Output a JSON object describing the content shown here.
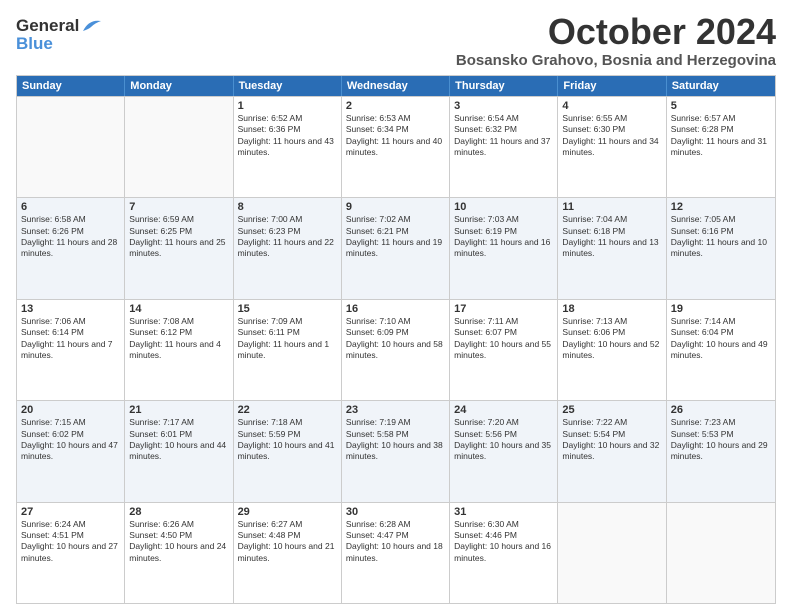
{
  "logo": {
    "general": "General",
    "blue": "Blue"
  },
  "title": "October 2024",
  "location": "Bosansko Grahovo, Bosnia and Herzegovina",
  "days_of_week": [
    "Sunday",
    "Monday",
    "Tuesday",
    "Wednesday",
    "Thursday",
    "Friday",
    "Saturday"
  ],
  "weeks": [
    [
      {
        "day": "",
        "sunrise": "",
        "sunset": "",
        "daylight": ""
      },
      {
        "day": "",
        "sunrise": "",
        "sunset": "",
        "daylight": ""
      },
      {
        "day": "1",
        "sunrise": "Sunrise: 6:52 AM",
        "sunset": "Sunset: 6:36 PM",
        "daylight": "Daylight: 11 hours and 43 minutes."
      },
      {
        "day": "2",
        "sunrise": "Sunrise: 6:53 AM",
        "sunset": "Sunset: 6:34 PM",
        "daylight": "Daylight: 11 hours and 40 minutes."
      },
      {
        "day": "3",
        "sunrise": "Sunrise: 6:54 AM",
        "sunset": "Sunset: 6:32 PM",
        "daylight": "Daylight: 11 hours and 37 minutes."
      },
      {
        "day": "4",
        "sunrise": "Sunrise: 6:55 AM",
        "sunset": "Sunset: 6:30 PM",
        "daylight": "Daylight: 11 hours and 34 minutes."
      },
      {
        "day": "5",
        "sunrise": "Sunrise: 6:57 AM",
        "sunset": "Sunset: 6:28 PM",
        "daylight": "Daylight: 11 hours and 31 minutes."
      }
    ],
    [
      {
        "day": "6",
        "sunrise": "Sunrise: 6:58 AM",
        "sunset": "Sunset: 6:26 PM",
        "daylight": "Daylight: 11 hours and 28 minutes."
      },
      {
        "day": "7",
        "sunrise": "Sunrise: 6:59 AM",
        "sunset": "Sunset: 6:25 PM",
        "daylight": "Daylight: 11 hours and 25 minutes."
      },
      {
        "day": "8",
        "sunrise": "Sunrise: 7:00 AM",
        "sunset": "Sunset: 6:23 PM",
        "daylight": "Daylight: 11 hours and 22 minutes."
      },
      {
        "day": "9",
        "sunrise": "Sunrise: 7:02 AM",
        "sunset": "Sunset: 6:21 PM",
        "daylight": "Daylight: 11 hours and 19 minutes."
      },
      {
        "day": "10",
        "sunrise": "Sunrise: 7:03 AM",
        "sunset": "Sunset: 6:19 PM",
        "daylight": "Daylight: 11 hours and 16 minutes."
      },
      {
        "day": "11",
        "sunrise": "Sunrise: 7:04 AM",
        "sunset": "Sunset: 6:18 PM",
        "daylight": "Daylight: 11 hours and 13 minutes."
      },
      {
        "day": "12",
        "sunrise": "Sunrise: 7:05 AM",
        "sunset": "Sunset: 6:16 PM",
        "daylight": "Daylight: 11 hours and 10 minutes."
      }
    ],
    [
      {
        "day": "13",
        "sunrise": "Sunrise: 7:06 AM",
        "sunset": "Sunset: 6:14 PM",
        "daylight": "Daylight: 11 hours and 7 minutes."
      },
      {
        "day": "14",
        "sunrise": "Sunrise: 7:08 AM",
        "sunset": "Sunset: 6:12 PM",
        "daylight": "Daylight: 11 hours and 4 minutes."
      },
      {
        "day": "15",
        "sunrise": "Sunrise: 7:09 AM",
        "sunset": "Sunset: 6:11 PM",
        "daylight": "Daylight: 11 hours and 1 minute."
      },
      {
        "day": "16",
        "sunrise": "Sunrise: 7:10 AM",
        "sunset": "Sunset: 6:09 PM",
        "daylight": "Daylight: 10 hours and 58 minutes."
      },
      {
        "day": "17",
        "sunrise": "Sunrise: 7:11 AM",
        "sunset": "Sunset: 6:07 PM",
        "daylight": "Daylight: 10 hours and 55 minutes."
      },
      {
        "day": "18",
        "sunrise": "Sunrise: 7:13 AM",
        "sunset": "Sunset: 6:06 PM",
        "daylight": "Daylight: 10 hours and 52 minutes."
      },
      {
        "day": "19",
        "sunrise": "Sunrise: 7:14 AM",
        "sunset": "Sunset: 6:04 PM",
        "daylight": "Daylight: 10 hours and 49 minutes."
      }
    ],
    [
      {
        "day": "20",
        "sunrise": "Sunrise: 7:15 AM",
        "sunset": "Sunset: 6:02 PM",
        "daylight": "Daylight: 10 hours and 47 minutes."
      },
      {
        "day": "21",
        "sunrise": "Sunrise: 7:17 AM",
        "sunset": "Sunset: 6:01 PM",
        "daylight": "Daylight: 10 hours and 44 minutes."
      },
      {
        "day": "22",
        "sunrise": "Sunrise: 7:18 AM",
        "sunset": "Sunset: 5:59 PM",
        "daylight": "Daylight: 10 hours and 41 minutes."
      },
      {
        "day": "23",
        "sunrise": "Sunrise: 7:19 AM",
        "sunset": "Sunset: 5:58 PM",
        "daylight": "Daylight: 10 hours and 38 minutes."
      },
      {
        "day": "24",
        "sunrise": "Sunrise: 7:20 AM",
        "sunset": "Sunset: 5:56 PM",
        "daylight": "Daylight: 10 hours and 35 minutes."
      },
      {
        "day": "25",
        "sunrise": "Sunrise: 7:22 AM",
        "sunset": "Sunset: 5:54 PM",
        "daylight": "Daylight: 10 hours and 32 minutes."
      },
      {
        "day": "26",
        "sunrise": "Sunrise: 7:23 AM",
        "sunset": "Sunset: 5:53 PM",
        "daylight": "Daylight: 10 hours and 29 minutes."
      }
    ],
    [
      {
        "day": "27",
        "sunrise": "Sunrise: 6:24 AM",
        "sunset": "Sunset: 4:51 PM",
        "daylight": "Daylight: 10 hours and 27 minutes."
      },
      {
        "day": "28",
        "sunrise": "Sunrise: 6:26 AM",
        "sunset": "Sunset: 4:50 PM",
        "daylight": "Daylight: 10 hours and 24 minutes."
      },
      {
        "day": "29",
        "sunrise": "Sunrise: 6:27 AM",
        "sunset": "Sunset: 4:48 PM",
        "daylight": "Daylight: 10 hours and 21 minutes."
      },
      {
        "day": "30",
        "sunrise": "Sunrise: 6:28 AM",
        "sunset": "Sunset: 4:47 PM",
        "daylight": "Daylight: 10 hours and 18 minutes."
      },
      {
        "day": "31",
        "sunrise": "Sunrise: 6:30 AM",
        "sunset": "Sunset: 4:46 PM",
        "daylight": "Daylight: 10 hours and 16 minutes."
      },
      {
        "day": "",
        "sunrise": "",
        "sunset": "",
        "daylight": ""
      },
      {
        "day": "",
        "sunrise": "",
        "sunset": "",
        "daylight": ""
      }
    ]
  ]
}
